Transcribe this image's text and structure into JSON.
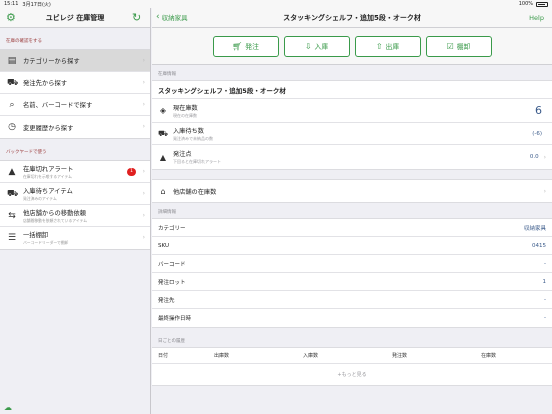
{
  "status_bar": {
    "time": "15:11",
    "date": "3月17日(火)",
    "battery": "100%"
  },
  "left": {
    "title": "ユビレジ 在庫管理",
    "section1": "在庫の確認をする",
    "menu1": [
      {
        "label": "カテゴリーから探す",
        "icon": "box-icon",
        "selected": true
      },
      {
        "label": "発注先から探す",
        "icon": "truck-icon"
      },
      {
        "label": "名前、バーコードで探す",
        "icon": "search-icon"
      },
      {
        "label": "変更履歴から探す",
        "icon": "clock-icon"
      }
    ],
    "section2": "バックヤードで使う",
    "menu2": [
      {
        "label": "在庫切れアラート",
        "sub": "在庫切れを示唆するアイテム",
        "icon": "alert-icon",
        "badge": "1"
      },
      {
        "label": "入庫待ちアイテム",
        "sub": "発注済みのアイテム",
        "icon": "truck-icon"
      },
      {
        "label": "他店舗からの移動依頼",
        "sub": "店舗間移動を依頼されているアイテム",
        "icon": "transfer-icon"
      },
      {
        "label": "一括棚卸",
        "sub": "バーコードリーダーで棚卸",
        "icon": "list-icon"
      }
    ]
  },
  "right": {
    "back_label": "収納家具",
    "title": "スタッキングシェルフ・追加5段・オーク材",
    "help": "Help",
    "actions": [
      {
        "label": "発注",
        "icon": "cart-icon"
      },
      {
        "label": "入庫",
        "icon": "inbox-icon"
      },
      {
        "label": "出庫",
        "icon": "outbox-icon"
      },
      {
        "label": "棚卸",
        "icon": "check-icon"
      }
    ],
    "stock_section": "在庫情報",
    "product_name": "スタッキングシェルフ・追加5段・オーク材",
    "stock": {
      "label": "現在庫数",
      "sub": "現在の在庫数",
      "value": "6"
    },
    "incoming": {
      "label": "入庫待ち数",
      "sub": "発注済みで未納品の数",
      "value": "(-6)"
    },
    "order_point": {
      "label": "発注点",
      "sub": "下回ると在庫切れアラート",
      "value": "0.0"
    },
    "other_stores": {
      "label": "他店舗の在庫数"
    },
    "detail_section": "詳細情報",
    "details": [
      {
        "label": "カテゴリー",
        "value": "収納家具"
      },
      {
        "label": "SKU",
        "value": "0415"
      },
      {
        "label": "バーコード",
        "value": "-"
      },
      {
        "label": "発注ロット",
        "value": "1"
      },
      {
        "label": "発注先",
        "value": "-"
      },
      {
        "label": "最終操作日時",
        "value": "-"
      }
    ],
    "history_section": "日ごとの履歴",
    "history_columns": [
      "日付",
      "出庫数",
      "入庫数",
      "発注数",
      "在庫数"
    ],
    "more_label": "+もっと見る"
  }
}
